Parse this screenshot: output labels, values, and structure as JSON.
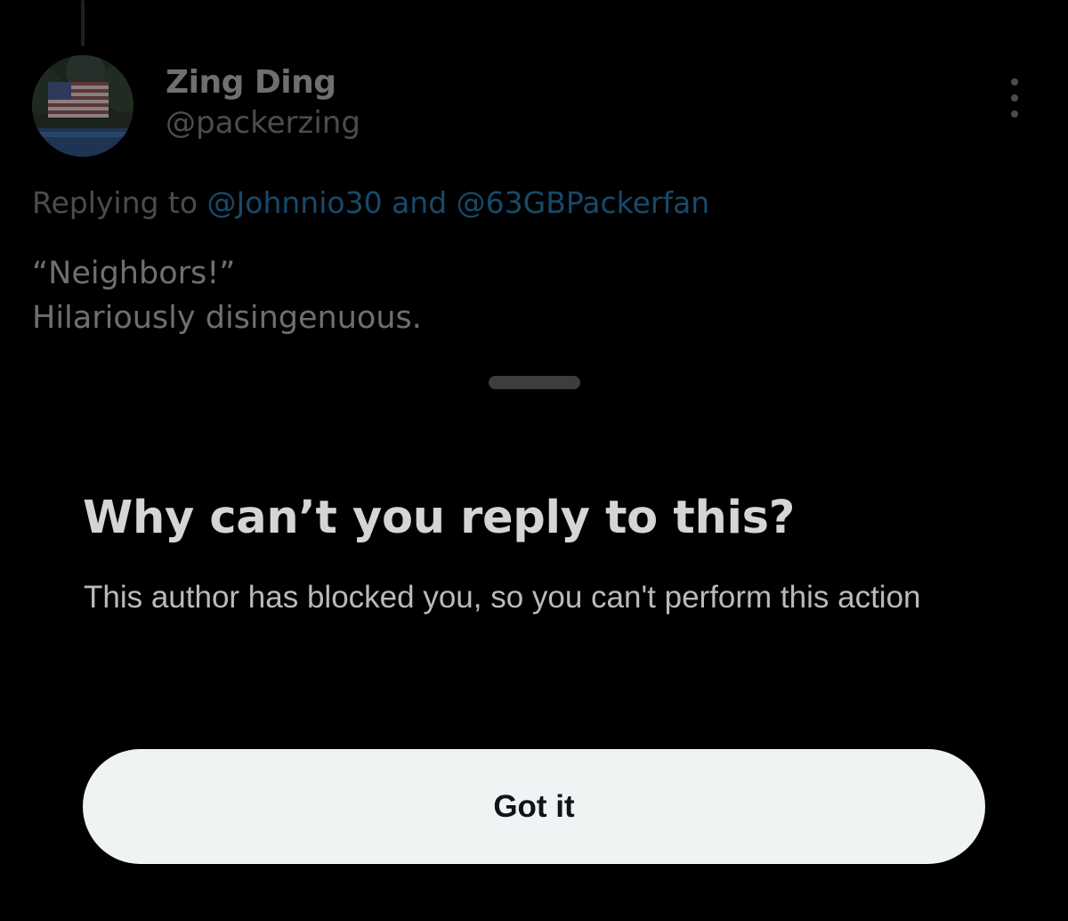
{
  "tweet": {
    "author_name": "Zing Ding",
    "author_handle": "@packerzing",
    "reply_prefix": "Replying to",
    "reply_mention_1": "@Johnnio30",
    "reply_and": "and",
    "reply_mention_2": "@63GBPackerfan",
    "text_line_1": "“Neighbors!”",
    "text_line_2": "Hilariously disingenuous."
  },
  "sheet": {
    "title": "Why can’t you reply to this?",
    "body": "This author has blocked you, so you can't perform this action",
    "button_label": "Got it"
  },
  "icons": {
    "more": "more-vertical-icon",
    "avatar": "avatar-flag-photo"
  },
  "colors": {
    "background": "#000000",
    "button_bg": "#eff3f4",
    "mention": "#174a6b"
  }
}
